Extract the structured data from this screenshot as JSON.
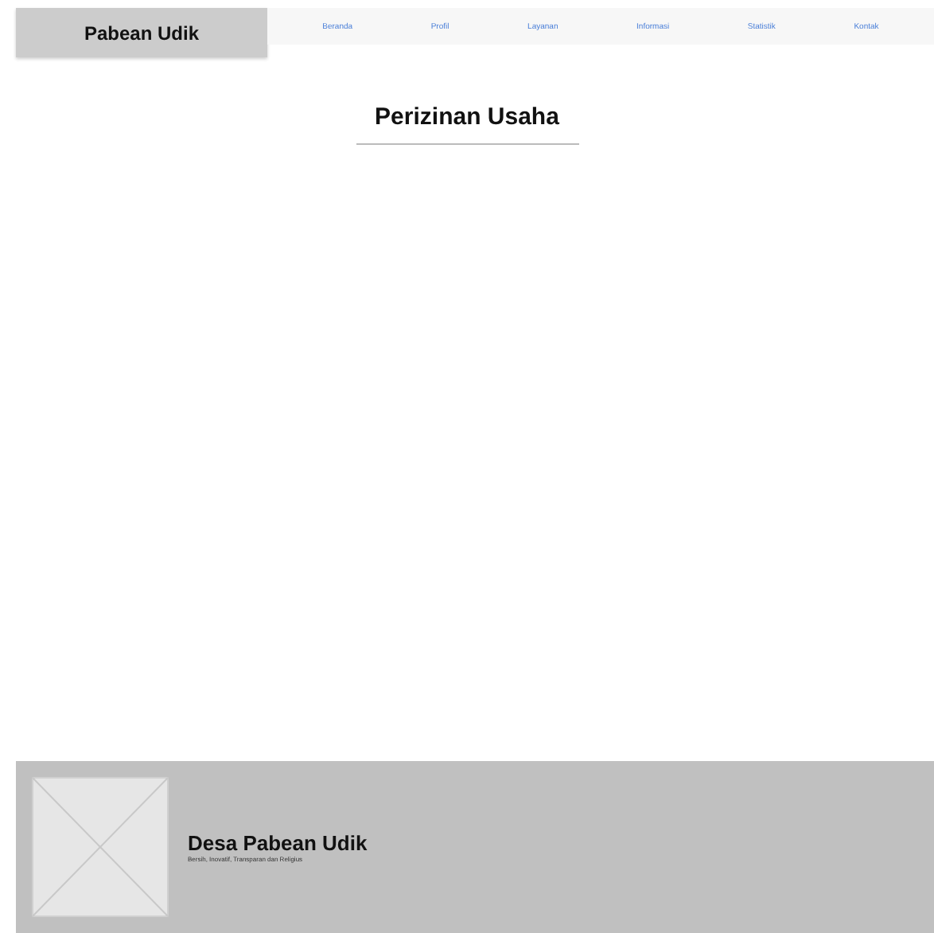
{
  "header": {
    "logo": "Pabean Udik",
    "nav": [
      {
        "label": "Beranda"
      },
      {
        "label": "Profil"
      },
      {
        "label": "Layanan"
      },
      {
        "label": "Informasi"
      },
      {
        "label": "Statistik"
      },
      {
        "label": "Kontak"
      }
    ]
  },
  "page_title": "Perizinan Usaha",
  "footer": {
    "title": "Desa Pabean Udik",
    "tagline": "Bersih, Inovatif, Transparan dan Religius"
  }
}
